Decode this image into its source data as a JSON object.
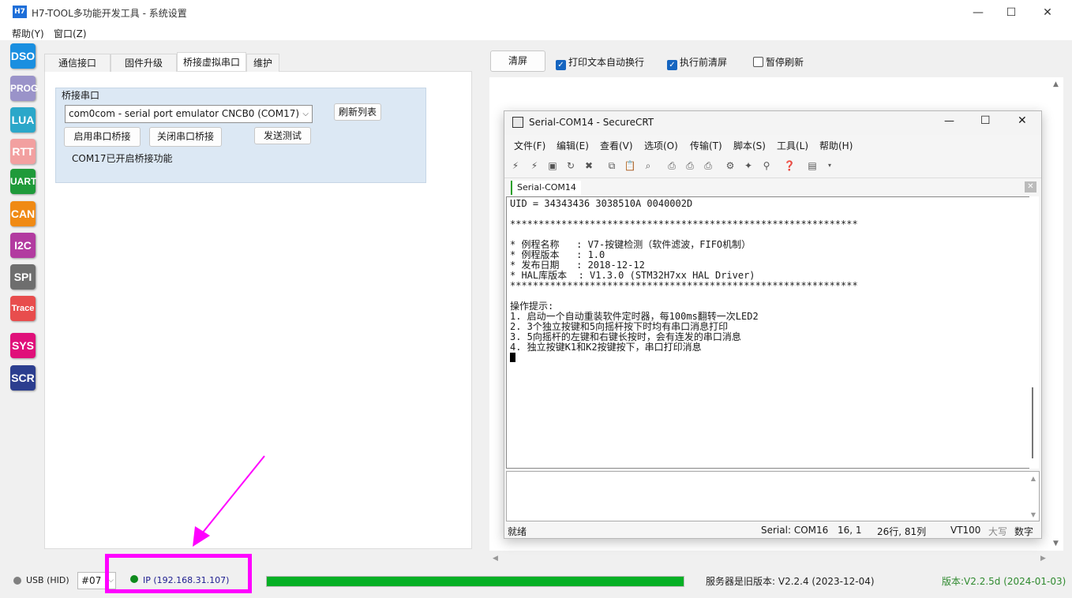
{
  "window": {
    "logo": "H7",
    "title": "H7-TOOL多功能开发工具 - 系统设置",
    "minimize": "—",
    "maximize": "☐",
    "close": "✕"
  },
  "menu": {
    "help": "帮助(Y)",
    "window": "窗口(Z)"
  },
  "tools": [
    {
      "label": "DSO",
      "color": "#1a8fe0"
    },
    {
      "label": "PROG",
      "color": "#9a93c9"
    },
    {
      "label": "LUA",
      "color": "#2ba7c9"
    },
    {
      "label": "RTT",
      "color": "#f2a0a0"
    },
    {
      "label": "UART",
      "color": "#1f9a3a"
    },
    {
      "label": "CAN",
      "color": "#f08a14"
    },
    {
      "label": "I2C",
      "color": "#b23ba0"
    },
    {
      "label": "SPI",
      "color": "#6e6e6e"
    },
    {
      "label": "Trace",
      "color": "#e84d4d"
    },
    {
      "label": "SYS",
      "color": "#e0107a"
    },
    {
      "label": "SCR",
      "color": "#2c3e8f"
    }
  ],
  "tabs": [
    "通信接口",
    "固件升级",
    "桥接虚拟串口",
    "维护"
  ],
  "bridge": {
    "group_label": "桥接串口",
    "port_selected": "com0com - serial port emulator CNCB0 (COM17)",
    "refresh_label": "刷新列表",
    "enable_label": "启用串口桥接",
    "disable_label": "关闭串口桥接",
    "send_test_label": "发送测试",
    "status": "COM17已开启桥接功能"
  },
  "right": {
    "clear_label": "清屏",
    "wrap_label": "打印文本自动换行",
    "wrap_checked": true,
    "clear_before_label": "执行前清屏",
    "clear_before_checked": true,
    "pause_label": "暂停刷新",
    "pause_checked": false
  },
  "crt": {
    "title": "Serial-COM14 - SecureCRT",
    "menu": [
      "文件(F)",
      "编辑(E)",
      "查看(V)",
      "选项(O)",
      "传输(T)",
      "脚本(S)",
      "工具(L)",
      "帮助(H)"
    ],
    "tab_label": "Serial-COM14",
    "terminal_lines": [
      "UID = 34343436 3038510A 0040002D",
      "",
      "*************************************************************",
      "",
      "* 例程名称   : V7-按键检测（软件滤波，FIFO机制）",
      "* 例程版本   : 1.0",
      "* 发布日期   : 2018-12-12",
      "* HAL库版本  : V1.3.0 (STM32H7xx HAL Driver)",
      "*************************************************************",
      "",
      "操作提示:",
      "1. 启动一个自动重装软件定时器，每100ms翻转一次LED2",
      "2. 3个独立按键和5向摇杆按下时均有串口消息打印",
      "3. 5向摇杆的左键和右键长按时，会有连发的串口消息",
      "4. 独立按键K1和K2按键按下，串口打印消息"
    ],
    "status_ready": "就绪",
    "status_port": "Serial: COM16",
    "status_pos": "16,   1",
    "status_size": "26行, 81列",
    "status_term": "VT100",
    "status_caps": "大写",
    "status_num": "数字"
  },
  "statusbar": {
    "usb_label": "USB (HID)",
    "device_id": "#07",
    "ip_label": "IP (192.168.31.107)",
    "progress": 1.0,
    "server_version": "服务器是旧版本: V2.2.4 (2023-12-04)",
    "app_version": "版本:V2.2.5d (2024-01-03)"
  }
}
